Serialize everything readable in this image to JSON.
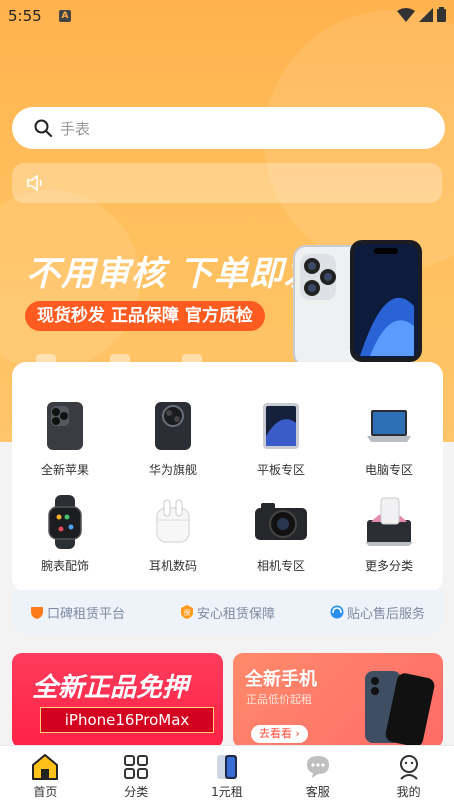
{
  "status_bar": {
    "time": "5:55",
    "badge": "A"
  },
  "search": {
    "placeholder": "手表"
  },
  "banner": {
    "headline": "不用审核  下单即发",
    "tagline": "现货秒发 正品保障 官方质检"
  },
  "categories": [
    {
      "label": "全新苹果",
      "icon": "iphone-icon"
    },
    {
      "label": "华为旗舰",
      "icon": "huawei-phone-icon"
    },
    {
      "label": "平板专区",
      "icon": "tablet-icon"
    },
    {
      "label": "电脑专区",
      "icon": "laptop-icon"
    },
    {
      "label": "腕表配饰",
      "icon": "watch-icon"
    },
    {
      "label": "耳机数码",
      "icon": "earbuds-icon"
    },
    {
      "label": "相机专区",
      "icon": "camera-icon"
    },
    {
      "label": "更多分类",
      "icon": "more-icon"
    }
  ],
  "guarantees": [
    {
      "label": "口碑租赁平台",
      "icon": "shield-icon"
    },
    {
      "label": "安心租赁保障",
      "icon": "badge-icon"
    },
    {
      "label": "贴心售后服务",
      "icon": "headset-icon"
    }
  ],
  "promo_left": {
    "title": "全新正品免押",
    "ribbon": "iPhone16ProMax"
  },
  "promo_right": {
    "title": "全新手机",
    "subtitle": "正品低价起租",
    "button": "去看看 ›"
  },
  "tabs": [
    {
      "label": "首页",
      "icon": "home-icon"
    },
    {
      "label": "分类",
      "icon": "grid-icon"
    },
    {
      "label": "1元租",
      "icon": "phone-thumb-icon"
    },
    {
      "label": "客服",
      "icon": "chat-icon"
    },
    {
      "label": "我的",
      "icon": "profile-icon"
    }
  ],
  "colors": {
    "accent": "#ffb24d",
    "orange": "#ff5a1f",
    "red": "#ff2248"
  }
}
